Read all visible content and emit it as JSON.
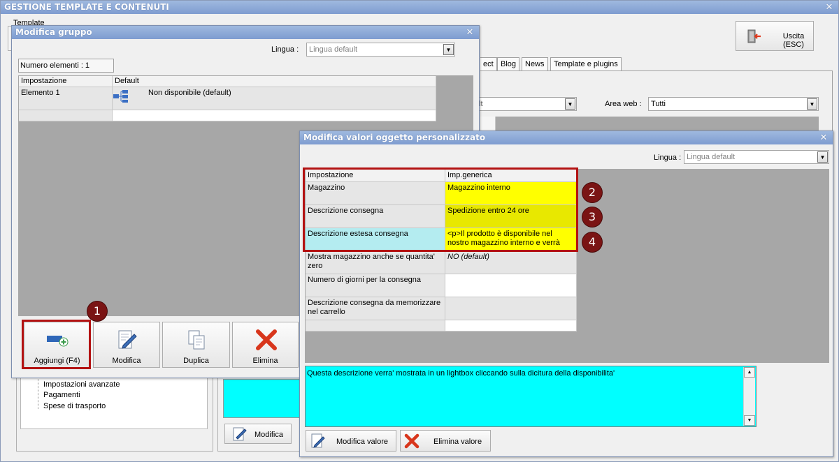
{
  "main": {
    "title": "GESTIONE TEMPLATE E CONTENUTI",
    "template_label": "Template",
    "exit_button": "Uscita (ESC)",
    "tabs": [
      "ect",
      "Blog",
      "News",
      "Template e plugins"
    ],
    "filter_combo_value": "ult",
    "area_web_label": "Area web :",
    "area_web_value": "Tutti",
    "tree_items": [
      "Impostazioni avanzate",
      "Pagamenti",
      "Spese di trasporto"
    ],
    "modify_button": "Modifica"
  },
  "group_dialog": {
    "title": "Modifica gruppo",
    "lingua_label": "Lingua :",
    "lingua_value": "Lingua default",
    "count_label": "Numero elementi : 1",
    "columns": [
      "Impostazione",
      "Default"
    ],
    "rows": [
      {
        "name": "Elemento 1",
        "value": "Non disponibile (default)"
      }
    ],
    "toolbar": {
      "add": "Aggiungi (F4)",
      "modify": "Modifica",
      "duplicate": "Duplica",
      "delete": "Elimina"
    }
  },
  "object_dialog": {
    "title": "Modifica valori oggetto personalizzato",
    "lingua_label": "Lingua :",
    "lingua_value": "Lingua default",
    "columns": [
      "Impostazione",
      "Imp.generica"
    ],
    "rows": [
      {
        "name": "Magazzino",
        "value": "Magazzino interno"
      },
      {
        "name": "Descrizione consegna",
        "value": "Spedizione entro 24 ore"
      },
      {
        "name": "Descrizione estesa consegna",
        "value": "<p>Il prodotto è disponibile nel nostro magazzino interno e verrà"
      },
      {
        "name": "Mostra magazzino anche se quantita' zero",
        "value": "NO (default)"
      },
      {
        "name": "Numero di giorni per la consegna",
        "value": ""
      },
      {
        "name": "Descrizione consegna da memorizzare nel carrello",
        "value": ""
      }
    ],
    "description_text": "Questa descrizione verra' mostrata in un lightbox cliccando sulla dicitura della disponibilita'",
    "modify_value_button": "Modifica valore",
    "delete_value_button": "Elimina valore"
  },
  "badges": [
    "1",
    "2",
    "3",
    "4"
  ],
  "colors": {
    "highlight_yellow": "#ffff00",
    "highlight_cyan": "#00ffff",
    "selected_row": "#b4ecf0",
    "callout_red": "#b31212",
    "badge": "#7a1414"
  }
}
